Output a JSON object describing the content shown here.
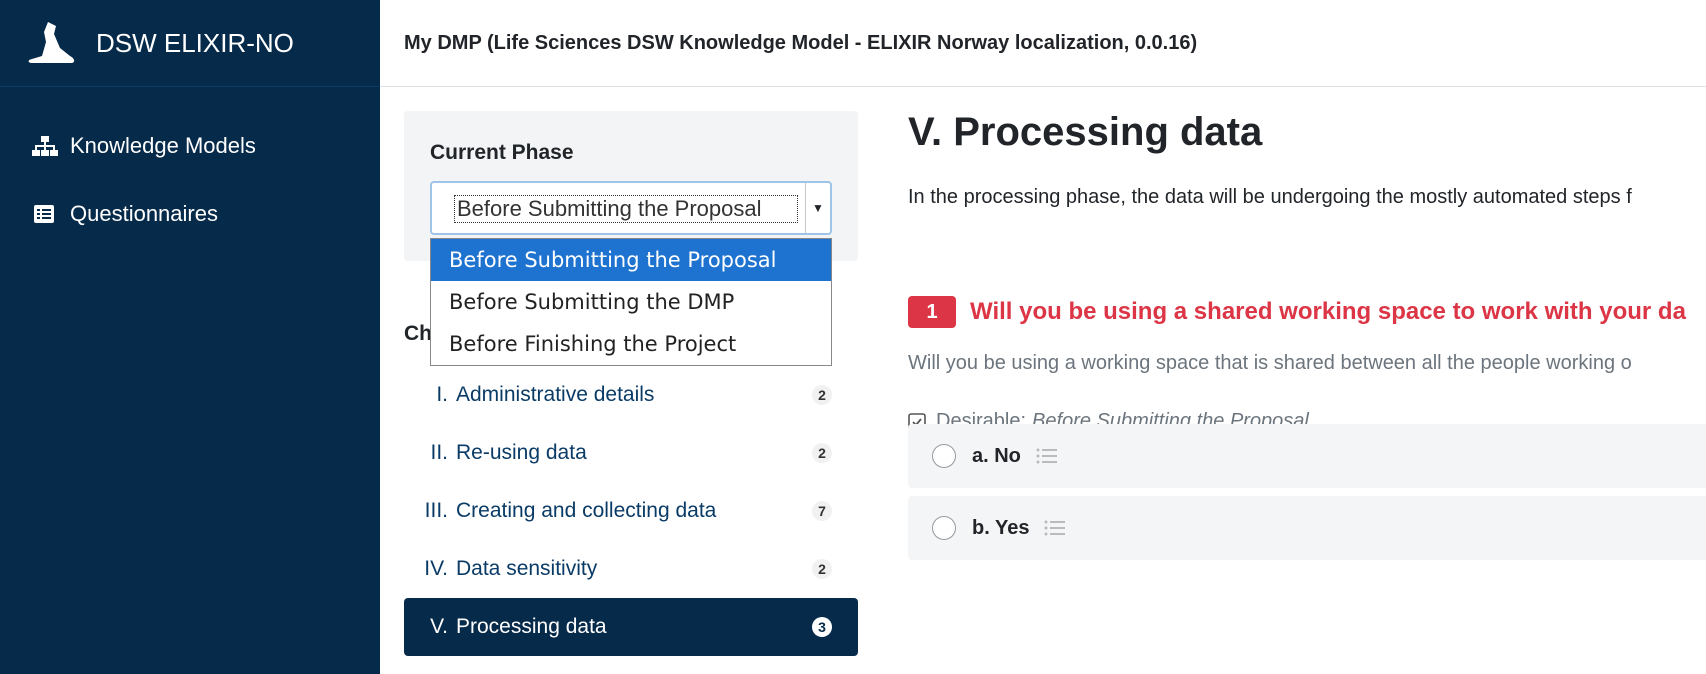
{
  "brand": {
    "name": "DSW ELIXIR-NO"
  },
  "sidebar": {
    "items": [
      {
        "label": "Knowledge Models",
        "icon": "sitemap-icon"
      },
      {
        "label": "Questionnaires",
        "icon": "list-alt-icon"
      }
    ]
  },
  "header": {
    "title": "My DMP (Life Sciences DSW Knowledge Model - ELIXIR Norway localization, 0.0.16)"
  },
  "phase": {
    "label": "Current Phase",
    "selected": "Before Submitting the Proposal",
    "options": [
      "Before Submitting the Proposal",
      "Before Submitting the DMP",
      "Before Finishing the Project"
    ]
  },
  "chapters": {
    "label_partial": "Ch",
    "items": [
      {
        "num": "I.",
        "title": "Administrative details",
        "count": "2"
      },
      {
        "num": "II.",
        "title": "Re-using data",
        "count": "2"
      },
      {
        "num": "III.",
        "title": "Creating and collecting data",
        "count": "7"
      },
      {
        "num": "IV.",
        "title": "Data sensitivity",
        "count": "2"
      },
      {
        "num": "V.",
        "title": "Processing data",
        "count": "3"
      }
    ]
  },
  "main": {
    "title": "V. Processing data",
    "intro": "In the processing phase, the data will be undergoing the mostly automated steps f",
    "question": {
      "number": "1",
      "text": "Will you be using a shared working space to work with your da",
      "description": "Will you be using a working space that is shared between all the people working o",
      "desirable_label": "Desirable:",
      "desirable_phase": "Before Submitting the Proposal",
      "answers": [
        {
          "label": "a. No"
        },
        {
          "label": "b. Yes"
        }
      ]
    }
  },
  "colors": {
    "sidebar_bg": "#062a4a",
    "accent": "#dc3545",
    "selected_option": "#1e73d0"
  }
}
